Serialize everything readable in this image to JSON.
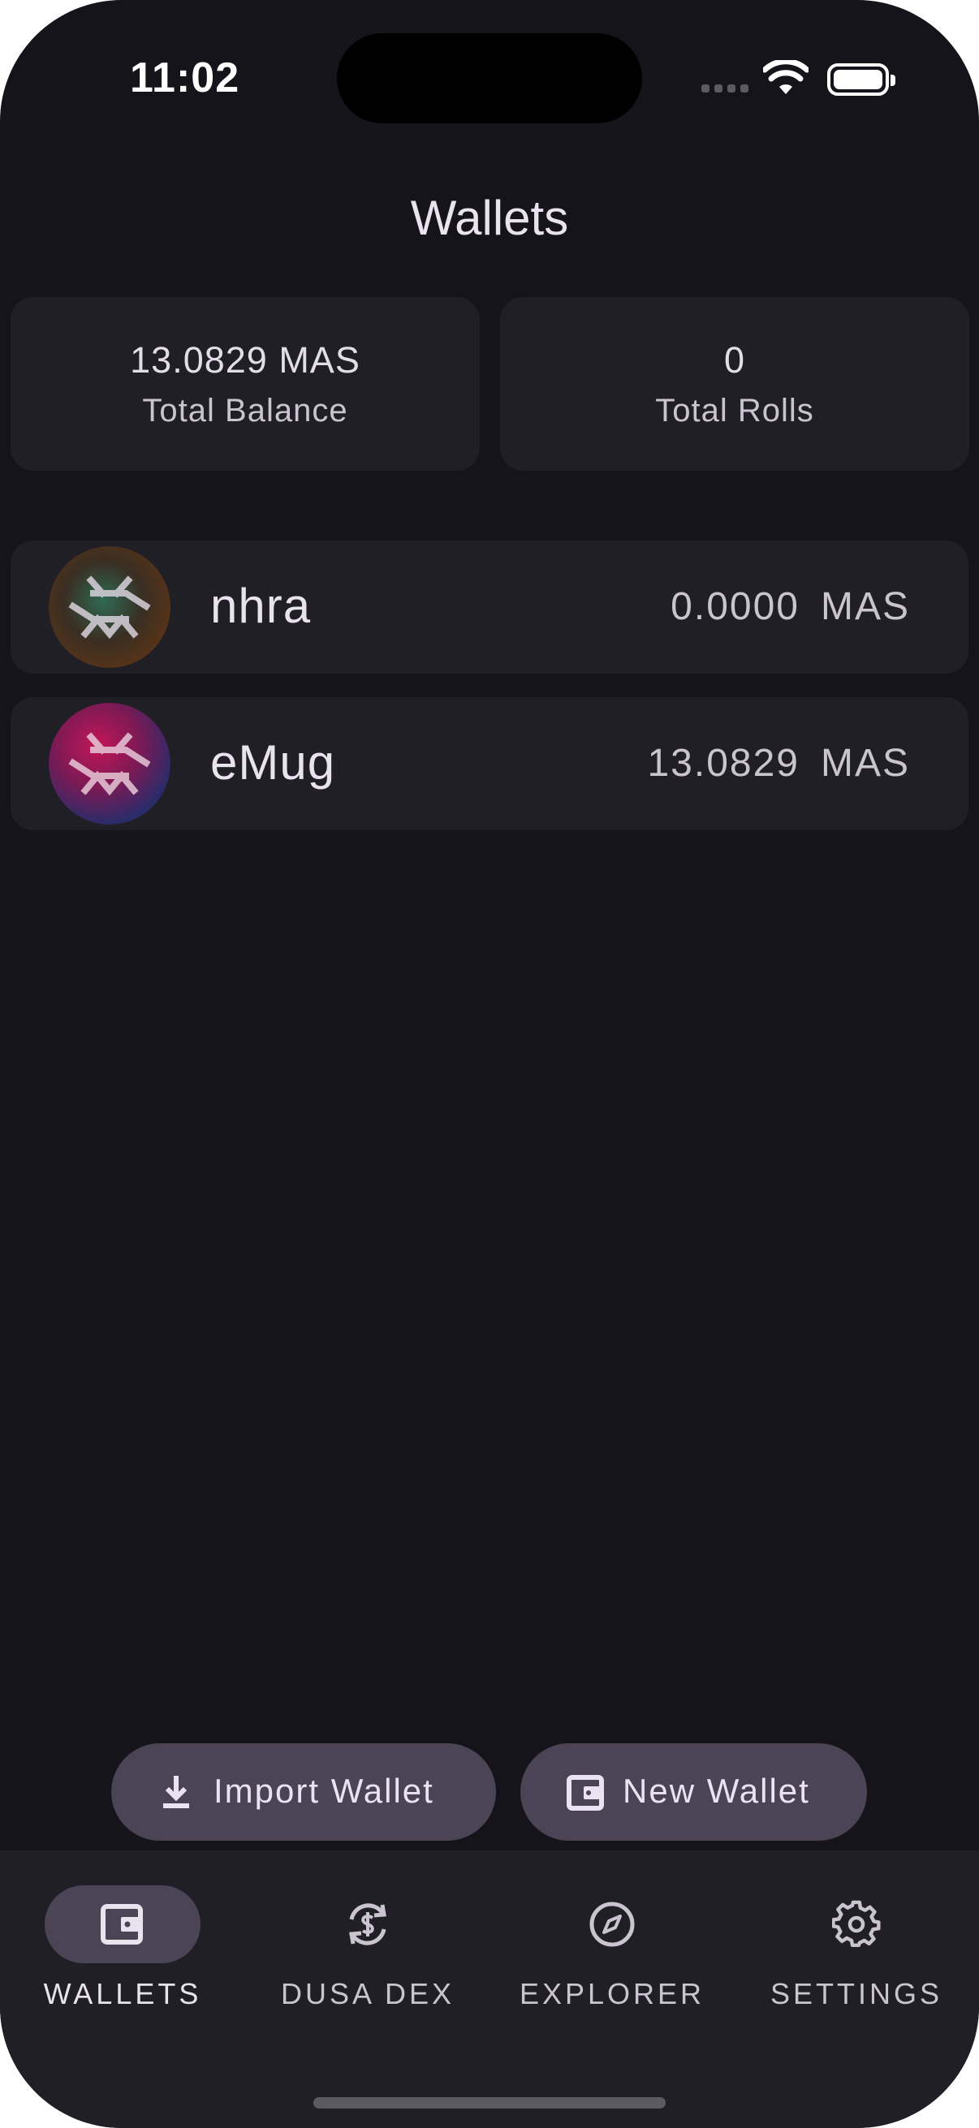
{
  "status_bar": {
    "time": "11:02"
  },
  "header": {
    "title": "Wallets"
  },
  "summary": {
    "total_balance_value": "13.0829 MAS",
    "total_balance_label": "Total Balance",
    "total_rolls_value": "0",
    "total_rolls_label": "Total Rolls"
  },
  "wallets": [
    {
      "name": "nhra",
      "balance": "0.0000",
      "unit": "MAS",
      "avatar_colors": [
        "#1f4a3a",
        "#5a3a1a"
      ]
    },
    {
      "name": "eMug",
      "balance": "13.0829",
      "unit": "MAS",
      "avatar_colors": [
        "#a0154a",
        "#2a2a6a"
      ]
    }
  ],
  "actions": {
    "import_label": "Import Wallet",
    "new_label": "New Wallet"
  },
  "nav": [
    {
      "label": "WALLETS",
      "icon": "wallet-icon",
      "active": true
    },
    {
      "label": "DUSA DEX",
      "icon": "exchange-dollar-icon",
      "active": false
    },
    {
      "label": "EXPLORER",
      "icon": "compass-icon",
      "active": false
    },
    {
      "label": "SETTINGS",
      "icon": "gear-icon",
      "active": false
    }
  ],
  "colors": {
    "background": "#16141b",
    "surface": "#211f26",
    "button": "#4a4456",
    "text_primary": "#e8e3ee",
    "text_secondary": "#c9c4d0"
  }
}
